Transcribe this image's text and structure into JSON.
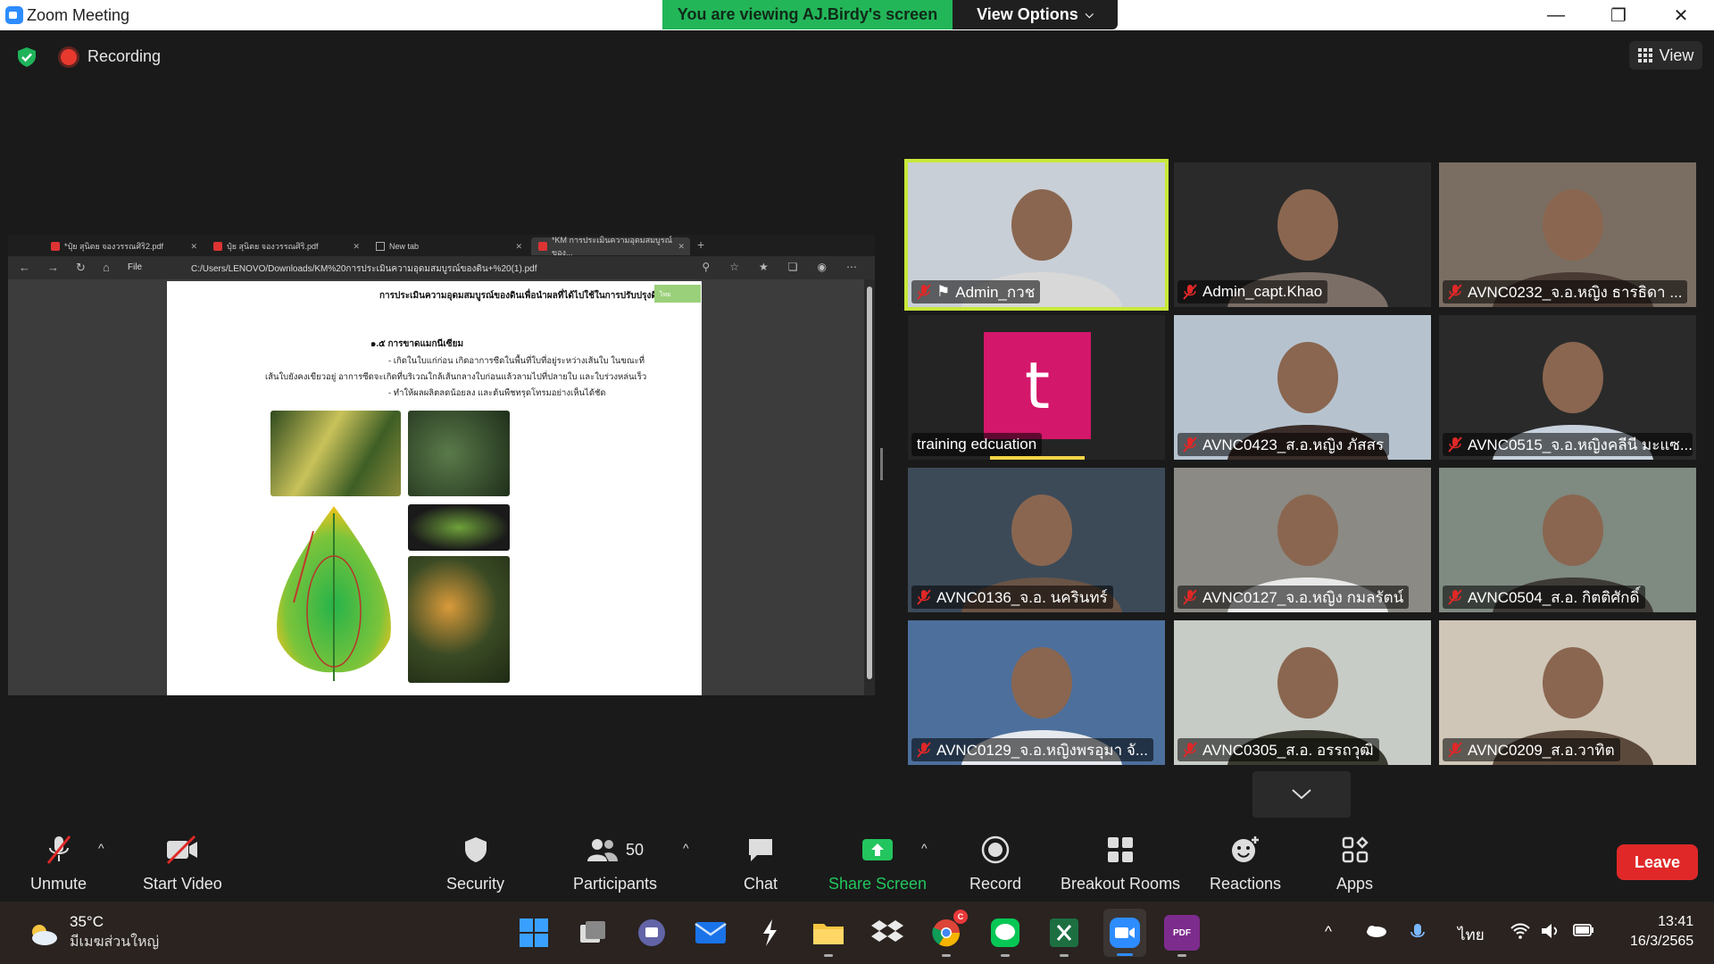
{
  "window": {
    "title": "Zoom Meeting",
    "banner": "You are viewing AJ.Birdy's screen",
    "view_options": "View Options"
  },
  "meeting_bar": {
    "recording": "Recording",
    "view": "View"
  },
  "shared_screen": {
    "tabs": [
      {
        "label": "*ปุ๋ย สุนิตย จองวรรณศิริ2.pdf"
      },
      {
        "label": "ปุ๋ย สุนิตย จองวรรณศิริ.pdf"
      },
      {
        "label": "New tab"
      },
      {
        "label": "*KM การประเมินความอุดมสมบูรณ์ของ..."
      }
    ],
    "file_label": "File",
    "url": "C:/Users/LENOVO/Downloads/KM%20การประเมินความอุดมสมบูรณ์ของดิน+%20(1).pdf",
    "doc": {
      "header": "การประเมินความอุดมสมบูรณ์ของดินเพื่อนำผลที่ได้ไปใช้ในการปรับปรุงดิน",
      "tag": "ไทย",
      "section": "๑.๕ การขาดแมกนีเซียม",
      "lines": [
        "- เกิดในใบแก่ก่อน เกิดอาการซีดในพื้นที่ใบที่อยู่ระหว่างเส้นใบ ในขณะที่",
        "เส้นใบยังคงเขียวอยู่ อาการซีดจะเกิดที่บริเวณใกล้เส้นกลางใบก่อนแล้วลามไปที่ปลายใบ และใบร่วงหล่นเร็ว",
        "- ทำให้ผลผลิตลดน้อยลง และต้นพืชทรุดโทรมอย่างเห็นได้ชัด"
      ]
    }
  },
  "participants_tiles": [
    {
      "name": "Admin_กวช",
      "muted": true,
      "pinned": true,
      "speaker": true,
      "bg": "#c9cfd6",
      "person": "#d8d8d8"
    },
    {
      "name": "Admin_capt.Khao",
      "muted": true,
      "bg": "#2a2a2a",
      "person": "#7b6e66"
    },
    {
      "name": "AVNC0232_จ.อ.หญิง ธารธิดา ...",
      "muted": true,
      "bg": "#7a6e62",
      "person": "#4a3a34"
    },
    {
      "name": "training edcuation",
      "muted": false,
      "avatar": "t",
      "bg": "#242424"
    },
    {
      "name": "AVNC0423_ส.อ.หญิง ภัสสร",
      "muted": true,
      "bg": "#b6c3cf",
      "person": "#3a2c28"
    },
    {
      "name": "AVNC0515_จ.อ.หญิงคลีนี มะแซ...",
      "muted": true,
      "bg": "#2a2a2a",
      "person": "#c8d2de"
    },
    {
      "name": "AVNC0136_จ.อ. นครินทร์",
      "muted": true,
      "bg": "#3c4a58",
      "person": "#6a5446"
    },
    {
      "name": "AVNC0127_จ.อ.หญิง กมลรัตน์",
      "muted": true,
      "bg": "#8c8a84",
      "person": "#e8e8e8"
    },
    {
      "name": "AVNC0504_ส.อ. กิตติศักดิ์",
      "muted": true,
      "bg": "#7f8a80",
      "person": "#3e3a36"
    },
    {
      "name": "AVNC0129_จ.อ.หญิงพรอุมา จั...",
      "muted": true,
      "bg": "#4d6f9c",
      "person": "#e6e9ee"
    },
    {
      "name": "AVNC0305_ส.อ. อรรถวุฒิ",
      "muted": true,
      "bg": "#c8ccc6",
      "person": "#3b3a30"
    },
    {
      "name": "AVNC0209_ส.อ.วาทิต",
      "muted": true,
      "bg": "#cfc6b8",
      "person": "#5b4a3c"
    }
  ],
  "toolbar": {
    "unmute": "Unmute",
    "start_video": "Start Video",
    "security": "Security",
    "participants": "Participants",
    "participants_count": "50",
    "chat": "Chat",
    "share_screen": "Share Screen",
    "record": "Record",
    "breakout_rooms": "Breakout Rooms",
    "reactions": "Reactions",
    "apps": "Apps",
    "leave": "Leave"
  },
  "taskbar": {
    "temperature": "35°C",
    "condition": "มีเมฆส่วนใหญ่",
    "language": "ไทย",
    "time": "13:41",
    "date": "16/3/2565",
    "chrome_badge": "C",
    "pdf_label": "PDF"
  }
}
